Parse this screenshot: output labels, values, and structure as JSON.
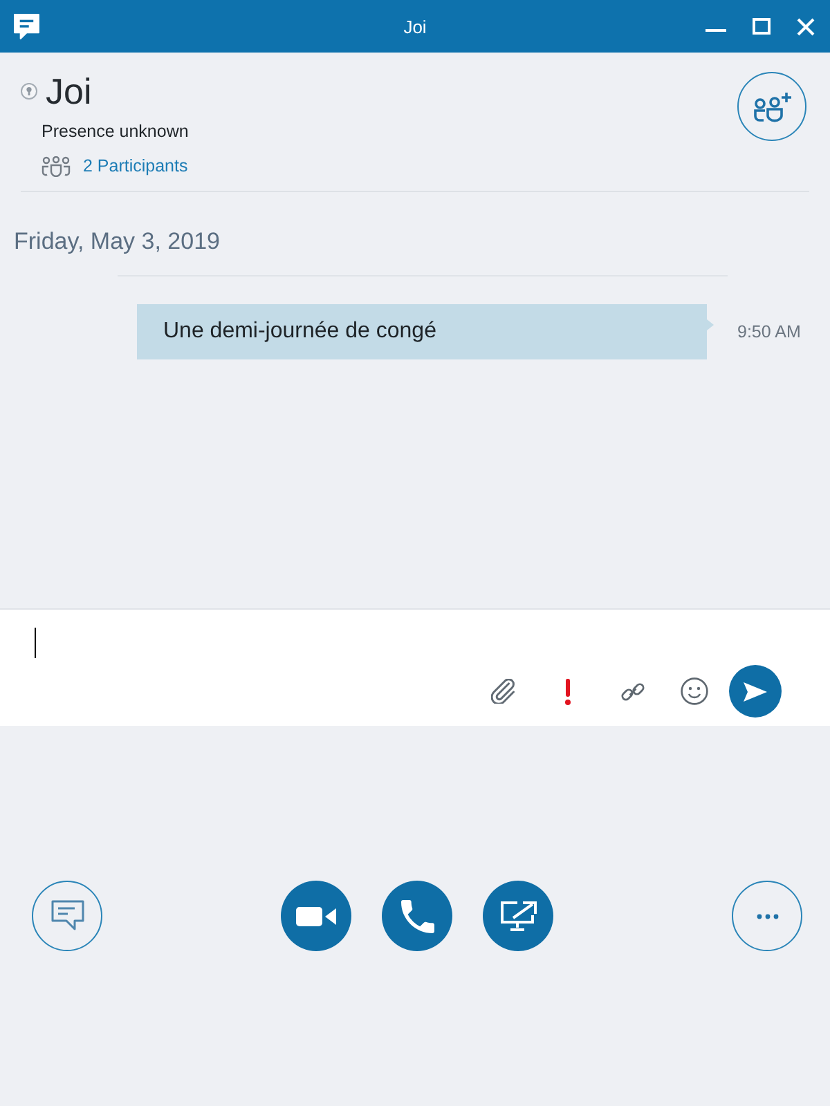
{
  "window": {
    "title": "Joi"
  },
  "header": {
    "contact_name": "Joi",
    "presence": "Presence unknown",
    "participants_link": "2 Participants"
  },
  "conversation": {
    "date": "Friday, May 3, 2019",
    "messages": [
      {
        "text": "Une demi-journée de congé",
        "time": "9:50 AM"
      }
    ]
  }
}
